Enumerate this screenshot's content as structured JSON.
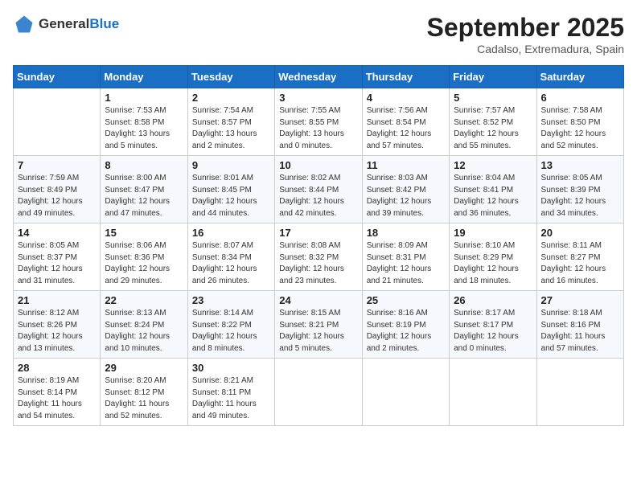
{
  "header": {
    "logo_general": "General",
    "logo_blue": "Blue",
    "month_title": "September 2025",
    "subtitle": "Cadalso, Extremadura, Spain"
  },
  "weekdays": [
    "Sunday",
    "Monday",
    "Tuesday",
    "Wednesday",
    "Thursday",
    "Friday",
    "Saturday"
  ],
  "weeks": [
    [
      {
        "day": "",
        "sunrise": "",
        "sunset": "",
        "daylight": ""
      },
      {
        "day": "1",
        "sunrise": "Sunrise: 7:53 AM",
        "sunset": "Sunset: 8:58 PM",
        "daylight": "Daylight: 13 hours and 5 minutes."
      },
      {
        "day": "2",
        "sunrise": "Sunrise: 7:54 AM",
        "sunset": "Sunset: 8:57 PM",
        "daylight": "Daylight: 13 hours and 2 minutes."
      },
      {
        "day": "3",
        "sunrise": "Sunrise: 7:55 AM",
        "sunset": "Sunset: 8:55 PM",
        "daylight": "Daylight: 13 hours and 0 minutes."
      },
      {
        "day": "4",
        "sunrise": "Sunrise: 7:56 AM",
        "sunset": "Sunset: 8:54 PM",
        "daylight": "Daylight: 12 hours and 57 minutes."
      },
      {
        "day": "5",
        "sunrise": "Sunrise: 7:57 AM",
        "sunset": "Sunset: 8:52 PM",
        "daylight": "Daylight: 12 hours and 55 minutes."
      },
      {
        "day": "6",
        "sunrise": "Sunrise: 7:58 AM",
        "sunset": "Sunset: 8:50 PM",
        "daylight": "Daylight: 12 hours and 52 minutes."
      }
    ],
    [
      {
        "day": "7",
        "sunrise": "Sunrise: 7:59 AM",
        "sunset": "Sunset: 8:49 PM",
        "daylight": "Daylight: 12 hours and 49 minutes."
      },
      {
        "day": "8",
        "sunrise": "Sunrise: 8:00 AM",
        "sunset": "Sunset: 8:47 PM",
        "daylight": "Daylight: 12 hours and 47 minutes."
      },
      {
        "day": "9",
        "sunrise": "Sunrise: 8:01 AM",
        "sunset": "Sunset: 8:45 PM",
        "daylight": "Daylight: 12 hours and 44 minutes."
      },
      {
        "day": "10",
        "sunrise": "Sunrise: 8:02 AM",
        "sunset": "Sunset: 8:44 PM",
        "daylight": "Daylight: 12 hours and 42 minutes."
      },
      {
        "day": "11",
        "sunrise": "Sunrise: 8:03 AM",
        "sunset": "Sunset: 8:42 PM",
        "daylight": "Daylight: 12 hours and 39 minutes."
      },
      {
        "day": "12",
        "sunrise": "Sunrise: 8:04 AM",
        "sunset": "Sunset: 8:41 PM",
        "daylight": "Daylight: 12 hours and 36 minutes."
      },
      {
        "day": "13",
        "sunrise": "Sunrise: 8:05 AM",
        "sunset": "Sunset: 8:39 PM",
        "daylight": "Daylight: 12 hours and 34 minutes."
      }
    ],
    [
      {
        "day": "14",
        "sunrise": "Sunrise: 8:05 AM",
        "sunset": "Sunset: 8:37 PM",
        "daylight": "Daylight: 12 hours and 31 minutes."
      },
      {
        "day": "15",
        "sunrise": "Sunrise: 8:06 AM",
        "sunset": "Sunset: 8:36 PM",
        "daylight": "Daylight: 12 hours and 29 minutes."
      },
      {
        "day": "16",
        "sunrise": "Sunrise: 8:07 AM",
        "sunset": "Sunset: 8:34 PM",
        "daylight": "Daylight: 12 hours and 26 minutes."
      },
      {
        "day": "17",
        "sunrise": "Sunrise: 8:08 AM",
        "sunset": "Sunset: 8:32 PM",
        "daylight": "Daylight: 12 hours and 23 minutes."
      },
      {
        "day": "18",
        "sunrise": "Sunrise: 8:09 AM",
        "sunset": "Sunset: 8:31 PM",
        "daylight": "Daylight: 12 hours and 21 minutes."
      },
      {
        "day": "19",
        "sunrise": "Sunrise: 8:10 AM",
        "sunset": "Sunset: 8:29 PM",
        "daylight": "Daylight: 12 hours and 18 minutes."
      },
      {
        "day": "20",
        "sunrise": "Sunrise: 8:11 AM",
        "sunset": "Sunset: 8:27 PM",
        "daylight": "Daylight: 12 hours and 16 minutes."
      }
    ],
    [
      {
        "day": "21",
        "sunrise": "Sunrise: 8:12 AM",
        "sunset": "Sunset: 8:26 PM",
        "daylight": "Daylight: 12 hours and 13 minutes."
      },
      {
        "day": "22",
        "sunrise": "Sunrise: 8:13 AM",
        "sunset": "Sunset: 8:24 PM",
        "daylight": "Daylight: 12 hours and 10 minutes."
      },
      {
        "day": "23",
        "sunrise": "Sunrise: 8:14 AM",
        "sunset": "Sunset: 8:22 PM",
        "daylight": "Daylight: 12 hours and 8 minutes."
      },
      {
        "day": "24",
        "sunrise": "Sunrise: 8:15 AM",
        "sunset": "Sunset: 8:21 PM",
        "daylight": "Daylight: 12 hours and 5 minutes."
      },
      {
        "day": "25",
        "sunrise": "Sunrise: 8:16 AM",
        "sunset": "Sunset: 8:19 PM",
        "daylight": "Daylight: 12 hours and 2 minutes."
      },
      {
        "day": "26",
        "sunrise": "Sunrise: 8:17 AM",
        "sunset": "Sunset: 8:17 PM",
        "daylight": "Daylight: 12 hours and 0 minutes."
      },
      {
        "day": "27",
        "sunrise": "Sunrise: 8:18 AM",
        "sunset": "Sunset: 8:16 PM",
        "daylight": "Daylight: 11 hours and 57 minutes."
      }
    ],
    [
      {
        "day": "28",
        "sunrise": "Sunrise: 8:19 AM",
        "sunset": "Sunset: 8:14 PM",
        "daylight": "Daylight: 11 hours and 54 minutes."
      },
      {
        "day": "29",
        "sunrise": "Sunrise: 8:20 AM",
        "sunset": "Sunset: 8:12 PM",
        "daylight": "Daylight: 11 hours and 52 minutes."
      },
      {
        "day": "30",
        "sunrise": "Sunrise: 8:21 AM",
        "sunset": "Sunset: 8:11 PM",
        "daylight": "Daylight: 11 hours and 49 minutes."
      },
      {
        "day": "",
        "sunrise": "",
        "sunset": "",
        "daylight": ""
      },
      {
        "day": "",
        "sunrise": "",
        "sunset": "",
        "daylight": ""
      },
      {
        "day": "",
        "sunrise": "",
        "sunset": "",
        "daylight": ""
      },
      {
        "day": "",
        "sunrise": "",
        "sunset": "",
        "daylight": ""
      }
    ]
  ]
}
